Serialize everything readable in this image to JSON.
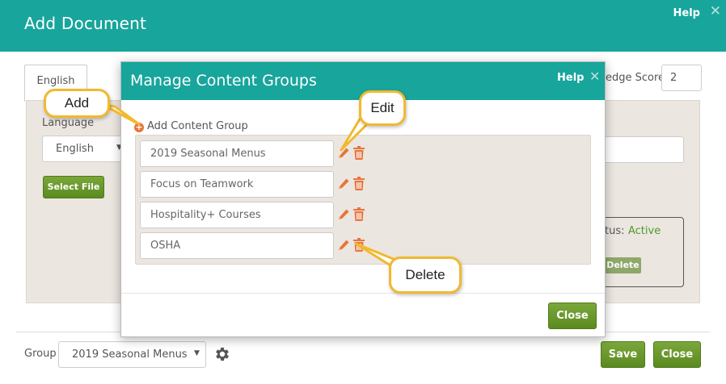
{
  "outer": {
    "title": "Add Document",
    "help": "Help",
    "close_glyph": "✕",
    "tab_english": "English",
    "score_label": "edge Score",
    "score_value": "2",
    "language_label": "Language",
    "language_value": "English",
    "select_file": "Select File",
    "status_label": "tus:",
    "status_value": "Active",
    "delete_label": "Delete",
    "group_label": "Group",
    "group_value": "2019 Seasonal Menus",
    "save": "Save",
    "close": "Close"
  },
  "modal": {
    "title": "Manage Content Groups",
    "help": "Help",
    "close_glyph": "✕",
    "add_group": "Add Content Group",
    "groups": [
      {
        "name": "2019 Seasonal Menus"
      },
      {
        "name": "Focus on Teamwork"
      },
      {
        "name": "Hospitality+ Courses"
      },
      {
        "name": "OSHA"
      }
    ],
    "close": "Close"
  },
  "callouts": {
    "add": "Add",
    "edit": "Edit",
    "delete": "Delete"
  },
  "colors": {
    "header_teal": "#17a59c",
    "button_green": "#6a9a2c",
    "icon_orange": "#e8743b",
    "callout_border": "#f2b82e",
    "status_green": "#4e9a2a"
  }
}
